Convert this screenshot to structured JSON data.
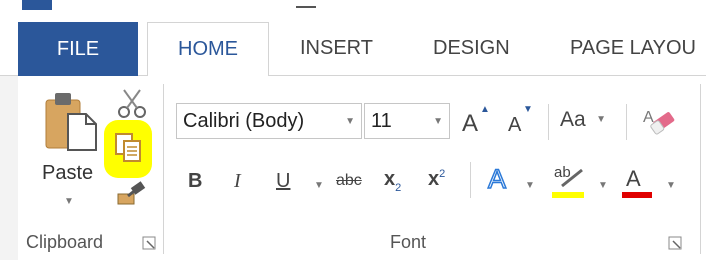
{
  "tabs": {
    "file": "FILE",
    "home": "HOME",
    "insert": "INSERT",
    "design": "DESIGN",
    "page_layout": "PAGE LAYOU"
  },
  "clipboard": {
    "paste_label": "Paste",
    "group_label": "Clipboard"
  },
  "font": {
    "font_name": "Calibri (Body)",
    "font_size": "11",
    "change_case_label": "Aa",
    "group_label": "Font",
    "bold": "B",
    "italic": "I",
    "underline": "U",
    "strikethrough": "abc",
    "subscript_base": "x",
    "subscript_sub": "2",
    "superscript_base": "x",
    "superscript_sup": "2",
    "grow_font": "A",
    "shrink_font": "A",
    "text_effects": "A",
    "highlight": "ab",
    "font_color": "A"
  },
  "colors": {
    "file_tab": "#2b579a",
    "highlight_yellow": "#ffff00",
    "font_color_red": "#e00000",
    "accent_blue": "#2b579a"
  }
}
